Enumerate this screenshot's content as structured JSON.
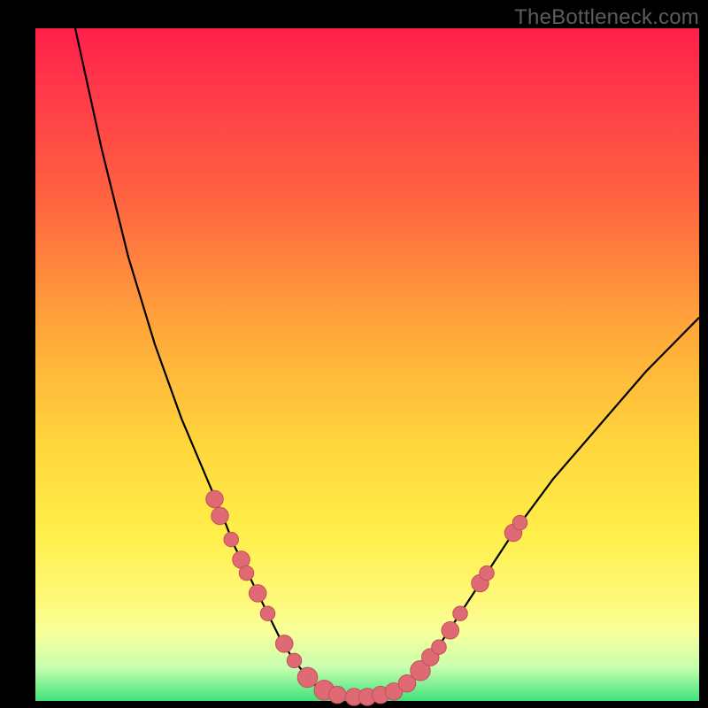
{
  "watermark": "TheBottleneck.com",
  "chart_data": {
    "type": "line",
    "title": "",
    "xlabel": "",
    "ylabel": "",
    "xlim": [
      0,
      100
    ],
    "ylim": [
      0,
      100
    ],
    "grid": false,
    "legend": false,
    "background_gradient": {
      "direction": "vertical",
      "stops": [
        {
          "pos": 0.0,
          "color": "#ff1f4a"
        },
        {
          "pos": 0.45,
          "color": "#ffa83a"
        },
        {
          "pos": 0.75,
          "color": "#ffef4a"
        },
        {
          "pos": 0.95,
          "color": "#c8ffb0"
        },
        {
          "pos": 1.0,
          "color": "#3fe27a"
        }
      ]
    },
    "series": [
      {
        "name": "left-branch",
        "x": [
          6.0,
          10.0,
          14.0,
          18.0,
          22.0,
          25.0,
          28.0,
          30.0,
          32.5,
          35.0,
          37.0,
          39.0,
          41.0,
          43.0
        ],
        "y": [
          100.0,
          82.0,
          66.0,
          53.0,
          42.0,
          35.0,
          28.0,
          23.0,
          18.0,
          13.0,
          9.0,
          6.0,
          3.5,
          1.5
        ]
      },
      {
        "name": "valley-floor",
        "x": [
          43.0,
          46.0,
          49.0,
          52.0,
          55.0
        ],
        "y": [
          1.5,
          0.8,
          0.6,
          0.8,
          1.8
        ]
      },
      {
        "name": "right-branch",
        "x": [
          55.0,
          58.0,
          61.0,
          64.0,
          68.0,
          72.0,
          78.0,
          85.0,
          92.0,
          100.0
        ],
        "y": [
          1.8,
          4.5,
          8.5,
          13.0,
          19.0,
          25.0,
          33.0,
          41.0,
          49.0,
          57.0
        ]
      }
    ],
    "markers": [
      {
        "x": 27.0,
        "y": 30.0,
        "r": 1.3
      },
      {
        "x": 27.8,
        "y": 27.5,
        "r": 1.3
      },
      {
        "x": 29.5,
        "y": 24.0,
        "r": 1.1
      },
      {
        "x": 31.0,
        "y": 21.0,
        "r": 1.3
      },
      {
        "x": 31.8,
        "y": 19.0,
        "r": 1.1
      },
      {
        "x": 33.5,
        "y": 16.0,
        "r": 1.3
      },
      {
        "x": 35.0,
        "y": 13.0,
        "r": 1.1
      },
      {
        "x": 37.5,
        "y": 8.5,
        "r": 1.3
      },
      {
        "x": 39.0,
        "y": 6.0,
        "r": 1.1
      },
      {
        "x": 41.0,
        "y": 3.5,
        "r": 1.5
      },
      {
        "x": 43.5,
        "y": 1.6,
        "r": 1.5
      },
      {
        "x": 45.5,
        "y": 0.9,
        "r": 1.3
      },
      {
        "x": 48.0,
        "y": 0.6,
        "r": 1.3
      },
      {
        "x": 50.0,
        "y": 0.6,
        "r": 1.3
      },
      {
        "x": 52.0,
        "y": 0.9,
        "r": 1.3
      },
      {
        "x": 54.0,
        "y": 1.4,
        "r": 1.3
      },
      {
        "x": 56.0,
        "y": 2.6,
        "r": 1.3
      },
      {
        "x": 58.0,
        "y": 4.5,
        "r": 1.5
      },
      {
        "x": 59.5,
        "y": 6.5,
        "r": 1.3
      },
      {
        "x": 60.8,
        "y": 8.0,
        "r": 1.1
      },
      {
        "x": 62.5,
        "y": 10.5,
        "r": 1.3
      },
      {
        "x": 64.0,
        "y": 13.0,
        "r": 1.1
      },
      {
        "x": 67.0,
        "y": 17.5,
        "r": 1.3
      },
      {
        "x": 68.0,
        "y": 19.0,
        "r": 1.1
      },
      {
        "x": 72.0,
        "y": 25.0,
        "r": 1.3
      },
      {
        "x": 73.0,
        "y": 26.5,
        "r": 1.1
      }
    ]
  }
}
